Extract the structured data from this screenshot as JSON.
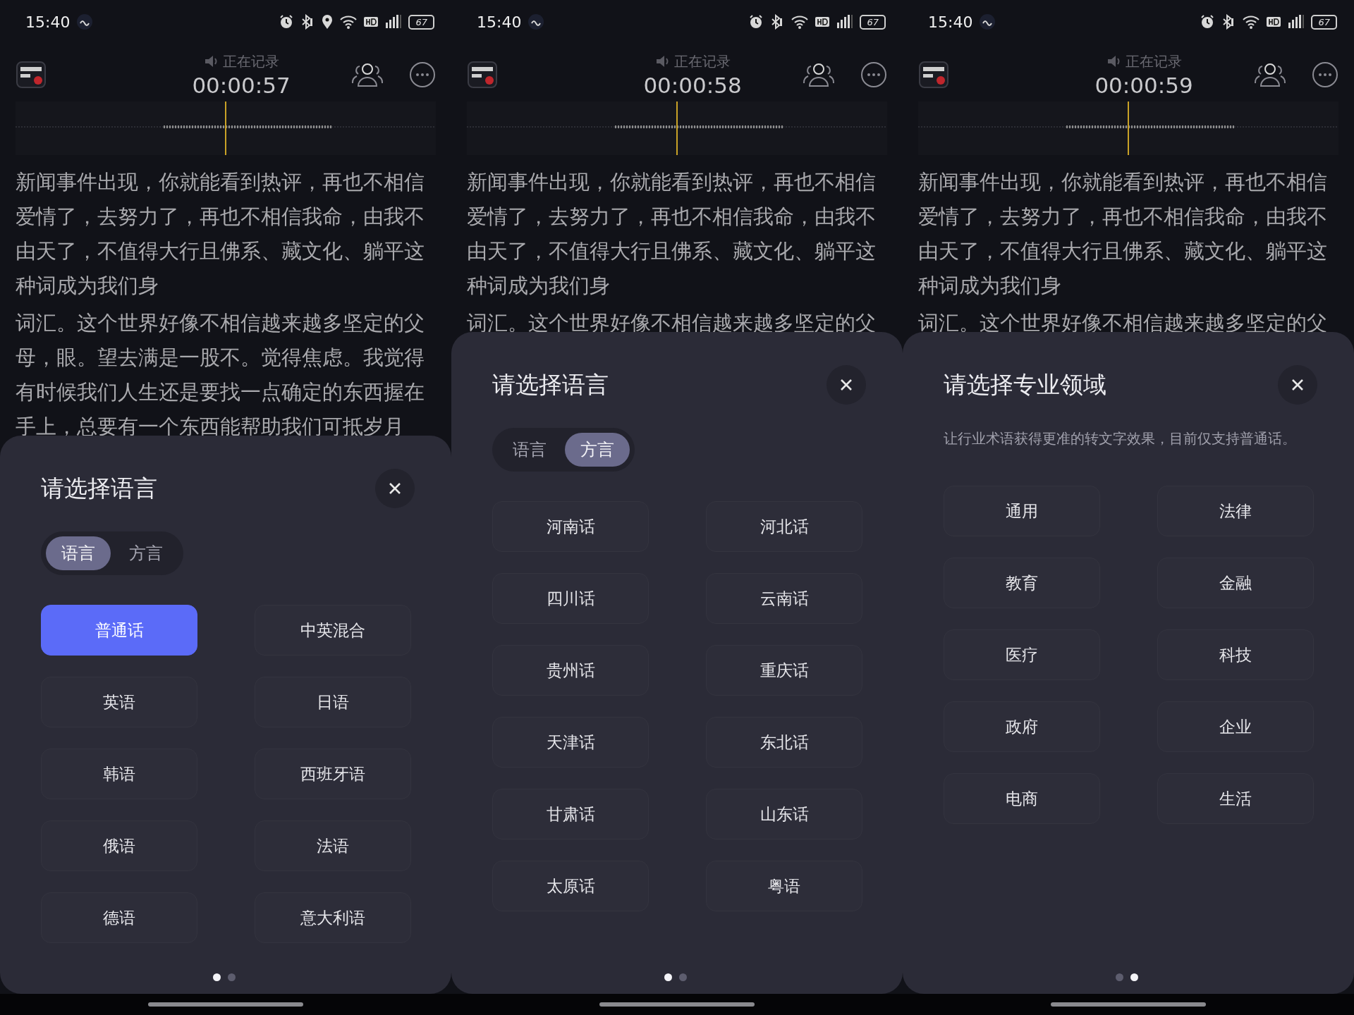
{
  "panels": [
    {
      "status_bar": {
        "time": "15:40",
        "location": true,
        "battery": "67"
      },
      "header": {
        "status": "正在记录",
        "timer": "00:00:57"
      },
      "transcript": [
        "新闻事件出现，你就能看到热评，再也不相信爱情了，去努力了，再也不相信我命，由我不由天了，不值得大行且佛系、藏文化、躺平这种词成为我们身",
        "词汇。这个世界好像不相信越来越多坚定的父母，眼。望去满是一股不。觉得焦虑。我觉得有时候我们人生还是要找一点确定的东西握在手上，总要有一个东西能帮助我们可抵岁月"
      ],
      "sheet": {
        "title": "请选择语言",
        "tabs": [
          {
            "label": "语言",
            "selected": true
          },
          {
            "label": "方言",
            "selected": false
          }
        ],
        "options": [
          {
            "label": "普通话",
            "selected": true
          },
          {
            "label": "中英混合",
            "selected": false
          },
          {
            "label": "英语",
            "selected": false
          },
          {
            "label": "日语",
            "selected": false
          },
          {
            "label": "韩语",
            "selected": false
          },
          {
            "label": "西班牙语",
            "selected": false
          },
          {
            "label": "俄语",
            "selected": false
          },
          {
            "label": "法语",
            "selected": false
          },
          {
            "label": "德语",
            "selected": false
          },
          {
            "label": "意大利语",
            "selected": false
          }
        ],
        "page_dots": [
          {
            "selected": true
          },
          {
            "selected": false
          }
        ]
      }
    },
    {
      "status_bar": {
        "time": "15:40",
        "location": false,
        "battery": "67"
      },
      "header": {
        "status": "正在记录",
        "timer": "00:00:58"
      },
      "transcript": [
        "新闻事件出现，你就能看到热评，再也不相信爱情了，去努力了，再也不相信我命，由我不由天了，不值得大行且佛系、藏文化、躺平这种词成为我们身",
        "词汇。这个世界好像不相信越来越多坚定的父"
      ],
      "sheet": {
        "title": "请选择语言",
        "tabs": [
          {
            "label": "语言",
            "selected": false
          },
          {
            "label": "方言",
            "selected": true
          }
        ],
        "options": [
          {
            "label": "河南话",
            "selected": false
          },
          {
            "label": "河北话",
            "selected": false
          },
          {
            "label": "四川话",
            "selected": false
          },
          {
            "label": "云南话",
            "selected": false
          },
          {
            "label": "贵州话",
            "selected": false
          },
          {
            "label": "重庆话",
            "selected": false
          },
          {
            "label": "天津话",
            "selected": false
          },
          {
            "label": "东北话",
            "selected": false
          },
          {
            "label": "甘肃话",
            "selected": false
          },
          {
            "label": "山东话",
            "selected": false
          },
          {
            "label": "太原话",
            "selected": false
          },
          {
            "label": "粤语",
            "selected": false
          }
        ],
        "page_dots": [
          {
            "selected": true
          },
          {
            "selected": false
          }
        ]
      }
    },
    {
      "status_bar": {
        "time": "15:40",
        "location": false,
        "battery": "67"
      },
      "header": {
        "status": "正在记录",
        "timer": "00:00:59"
      },
      "transcript": [
        "新闻事件出现，你就能看到热评，再也不相信爱情了，去努力了，再也不相信我命，由我不由天了，不值得大行且佛系、藏文化、躺平这种词成为我们身",
        "词汇。这个世界好像不相信越来越多坚定的父"
      ],
      "sheet": {
        "title": "请选择专业领域",
        "subtitle": "让行业术语获得更准的转文字效果，目前仅支持普通话。",
        "options": [
          {
            "label": "通用",
            "selected": false
          },
          {
            "label": "法律",
            "selected": false
          },
          {
            "label": "教育",
            "selected": false
          },
          {
            "label": "金融",
            "selected": false
          },
          {
            "label": "医疗",
            "selected": false
          },
          {
            "label": "科技",
            "selected": false
          },
          {
            "label": "政府",
            "selected": false
          },
          {
            "label": "企业",
            "selected": false
          },
          {
            "label": "电商",
            "selected": false
          },
          {
            "label": "生活",
            "selected": false
          }
        ],
        "page_dots": [
          {
            "selected": false
          },
          {
            "selected": true
          }
        ]
      }
    }
  ]
}
